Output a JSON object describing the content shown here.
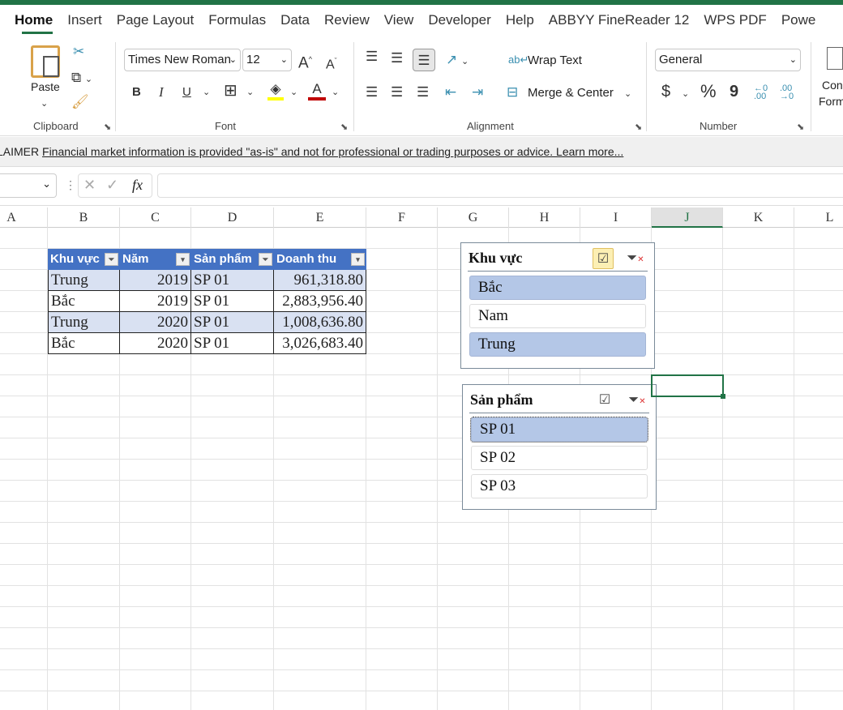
{
  "ribbon_tabs": [
    "Home",
    "Insert",
    "Page Layout",
    "Formulas",
    "Data",
    "Review",
    "View",
    "Developer",
    "Help",
    "ABBYY FineReader 12",
    "WPS PDF",
    "Powe"
  ],
  "clipboard": {
    "paste": "Paste",
    "label": "Clipboard"
  },
  "font": {
    "name": "Times New Roman",
    "size": "12",
    "label": "Font",
    "bold": "B",
    "italic": "I",
    "underline": "U"
  },
  "alignment": {
    "wrap": "Wrap Text",
    "merge": "Merge & Center",
    "label": "Alignment"
  },
  "number": {
    "format": "General",
    "currency": "$",
    "percent": "%",
    "comma": "9",
    "label": "Number"
  },
  "styles": {
    "cond1": "Con",
    "cond2": "Form"
  },
  "message": {
    "prefix": "LAIMER",
    "text": "Financial market information is provided \"as-is\" and not for professional or trading purposes or advice. Learn more..."
  },
  "formula": {
    "fx": "fx",
    "value": ""
  },
  "columns": [
    "A",
    "B",
    "C",
    "D",
    "E",
    "F",
    "G",
    "H",
    "I",
    "J",
    "K",
    "L"
  ],
  "selected_column": "J",
  "table": {
    "headers": [
      "Khu vực",
      "Năm",
      "Sản phẩm",
      "Doanh thu"
    ],
    "rows": [
      [
        "Trung",
        "2019",
        "SP 01",
        "961,318.80"
      ],
      [
        "Bắc",
        "2019",
        "SP 01",
        "2,883,956.40"
      ],
      [
        "Trung",
        "2020",
        "SP 01",
        "1,008,636.80"
      ],
      [
        "Bắc",
        "2020",
        "SP 01",
        "3,026,683.40"
      ]
    ]
  },
  "slicer1": {
    "title": "Khu vực",
    "items": [
      {
        "label": "Bắc",
        "selected": true
      },
      {
        "label": "Nam",
        "selected": false
      },
      {
        "label": "Trung",
        "selected": true
      }
    ]
  },
  "slicer2": {
    "title": "Sản phẩm",
    "items": [
      {
        "label": "SP 01",
        "selected": true
      },
      {
        "label": "SP 02",
        "selected": false
      },
      {
        "label": "SP 03",
        "selected": false
      }
    ]
  },
  "colors": {
    "accent": "#217346",
    "table_header": "#4472c4",
    "band": "#d9e1f2",
    "slicer_selected": "#b4c7e7"
  }
}
